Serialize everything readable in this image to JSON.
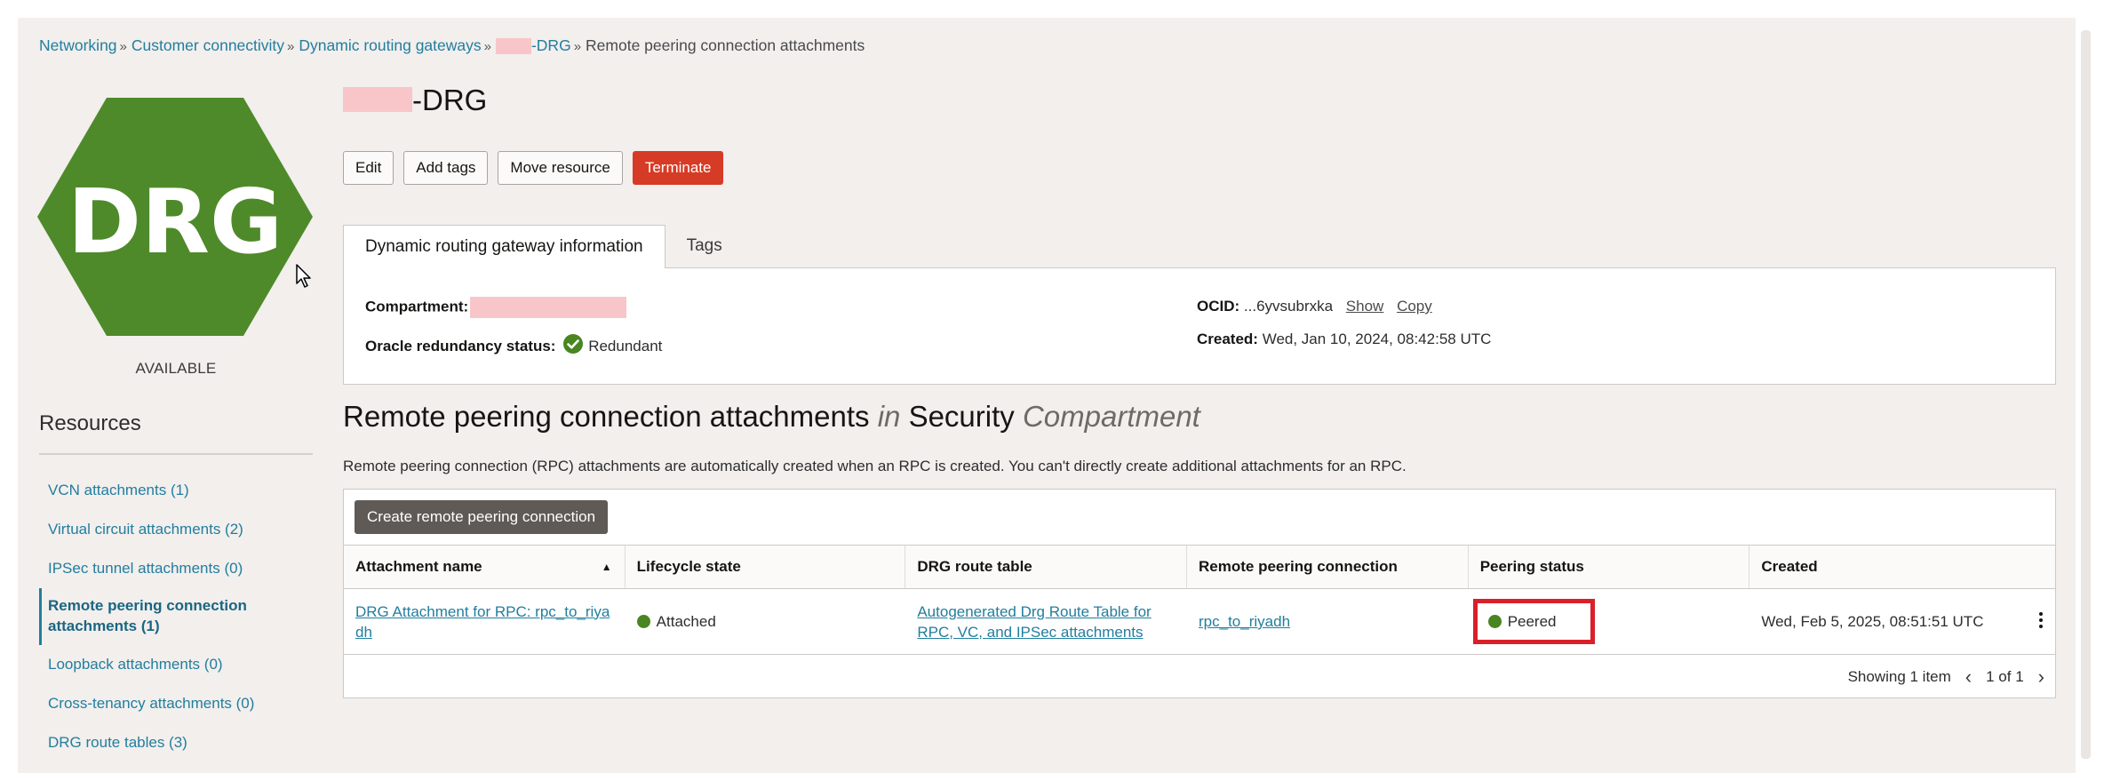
{
  "breadcrumb": {
    "items": [
      "Networking",
      "Customer connectivity",
      "Dynamic routing gateways",
      "-DRG"
    ],
    "current": "Remote peering connection attachments",
    "separator": "»"
  },
  "logo": {
    "text": "DRG",
    "color": "#4f8a2a"
  },
  "resource_status": "AVAILABLE",
  "page_title_suffix": "-DRG",
  "actions": {
    "edit": "Edit",
    "add_tags": "Add tags",
    "move": "Move resource",
    "terminate": "Terminate"
  },
  "tabs": [
    "Dynamic routing gateway information",
    "Tags"
  ],
  "info": {
    "compartment_label": "Compartment:",
    "redundancy_label": "Oracle redundancy status:",
    "redundancy_value": "Redundant",
    "ocid_label": "OCID:",
    "ocid_value": "...6yvsubrxka",
    "show_link": "Show",
    "copy_link": "Copy",
    "created_label": "Created:",
    "created_value": "Wed, Jan 10, 2024, 08:42:58 UTC"
  },
  "resources": {
    "heading": "Resources",
    "items": [
      "VCN attachments (1)",
      "Virtual circuit attachments (2)",
      "IPSec tunnel attachments (0)",
      "Remote peering connection attachments (1)",
      "Loopback attachments (0)",
      "Cross-tenancy attachments (0)",
      "DRG route tables (3)"
    ],
    "active_index": 3
  },
  "section": {
    "title_main": "Remote peering connection attachments",
    "title_in": "in",
    "title_compartment": "Security",
    "title_compartment_word": "Compartment",
    "description": "Remote peering connection (RPC) attachments are automatically created when an RPC is created. You can't directly create additional attachments for an RPC."
  },
  "table": {
    "create_button": "Create remote peering connection",
    "columns": [
      "Attachment name",
      "Lifecycle state",
      "DRG route table",
      "Remote peering connection",
      "Peering status",
      "Created"
    ],
    "rows": [
      {
        "attachment_name": "DRG Attachment for RPC: rpc_to_riyadh",
        "lifecycle_state": "Attached",
        "route_table": "Autogenerated Drg Route Table for RPC, VC, and IPSec attachments",
        "rpc": "rpc_to_riyadh",
        "peering_status": "Peered",
        "created": "Wed, Feb 5, 2025, 08:51:51 UTC"
      }
    ],
    "footer_showing": "Showing 1 item",
    "footer_page": "1 of 1"
  },
  "colors": {
    "link": "#227e9e",
    "danger": "#d63b25",
    "status_green": "#498520",
    "highlight": "#d9202a"
  }
}
